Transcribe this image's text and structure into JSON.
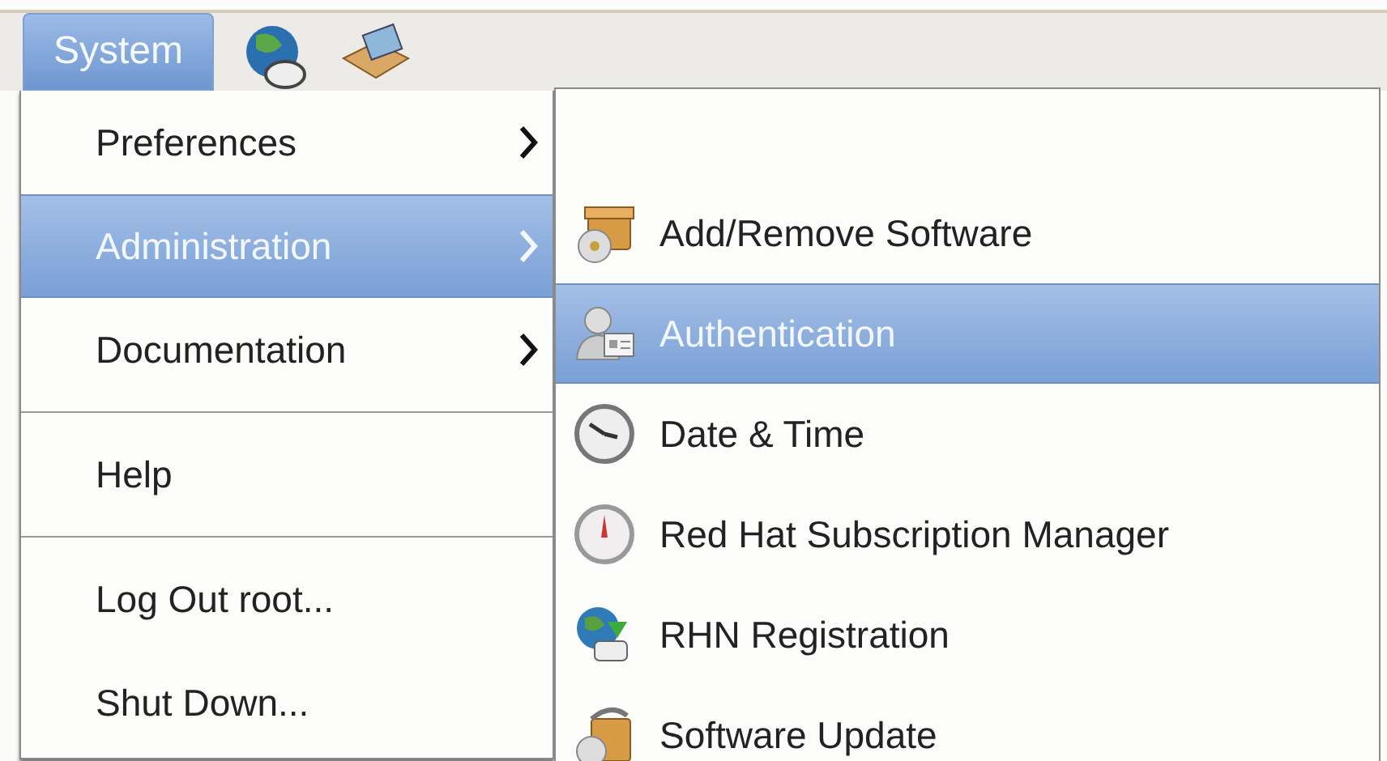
{
  "panel": {
    "menu_button": {
      "label": "System",
      "selected": true
    },
    "launchers": [
      {
        "kind": "globe"
      },
      {
        "kind": "package"
      }
    ]
  },
  "menu": {
    "items": [
      {
        "kind": "item",
        "label": "Preferences",
        "submenu": true,
        "selected": false
      },
      {
        "kind": "item",
        "label": "Administration",
        "submenu": true,
        "selected": true
      },
      {
        "kind": "item",
        "label": "Documentation",
        "submenu": true,
        "selected": false
      },
      {
        "kind": "separator"
      },
      {
        "kind": "item",
        "label": "Help",
        "submenu": false,
        "selected": false
      },
      {
        "kind": "separator"
      },
      {
        "kind": "item",
        "label": "Log Out root...",
        "submenu": false,
        "selected": false
      },
      {
        "kind": "item",
        "label": "Shut Down...",
        "submenu": false,
        "selected": false
      }
    ]
  },
  "submenu": {
    "items": [
      {
        "kind": "box",
        "label": "Add/Remove Software",
        "selected": false
      },
      {
        "kind": "user",
        "label": "Authentication",
        "selected": true
      },
      {
        "kind": "clock",
        "label": "Date & Time",
        "selected": false
      },
      {
        "kind": "gauge",
        "label": "Red Hat Subscription Manager",
        "selected": false
      },
      {
        "kind": "globe",
        "label": "RHN Registration",
        "selected": false
      },
      {
        "kind": "update",
        "label": "Software Update",
        "selected": false
      }
    ]
  }
}
